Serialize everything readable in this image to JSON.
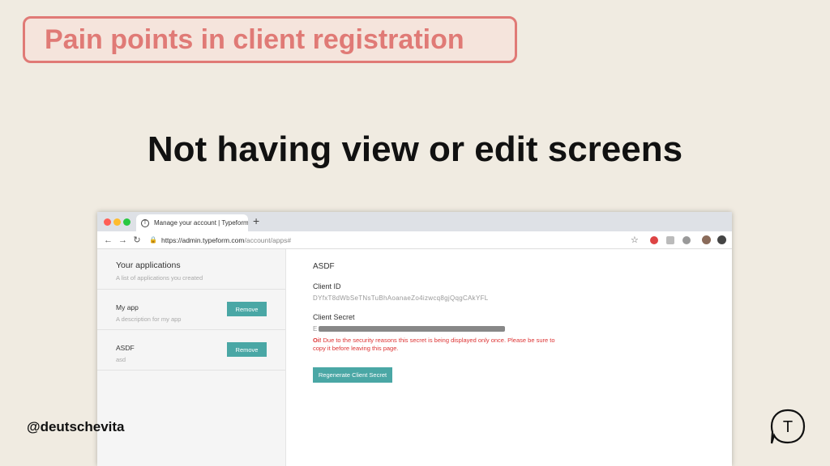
{
  "slide": {
    "title": "Pain points in client registration",
    "headline": "Not having view or edit screens",
    "handle": "@deutschevita",
    "logo_letter": "T"
  },
  "browser": {
    "tab_favicon": "T",
    "tab_title": "Manage your account | Typeform",
    "new_tab": "+",
    "url_host": "https://admin.typeform.com",
    "url_path": "/account/apps#"
  },
  "sidebar": {
    "title": "Your applications",
    "subtitle": "A list of applications you created",
    "apps": [
      {
        "name": "My app",
        "description": "A description for my app",
        "button": "Remove"
      },
      {
        "name": "ASDF",
        "description": "asd",
        "button": "Remove"
      }
    ]
  },
  "detail": {
    "app_name": "ASDF",
    "client_id_label": "Client ID",
    "client_id": "DYfxT8dWbSeTNsTuBhAoanaeZo4izwcq8gjQqgCAkYFL",
    "client_secret_label": "Client Secret",
    "client_secret_first": "E",
    "warning_bold": "Oi!",
    "warning_text": " Due to the security reasons this secret is being displayed only once. Please be sure to copy it before leaving this page.",
    "regenerate_button": "Regenerate Client Secret"
  },
  "colors": {
    "accent": "#e07a76",
    "button": "#4aa7a5",
    "warning": "#dd3333"
  }
}
